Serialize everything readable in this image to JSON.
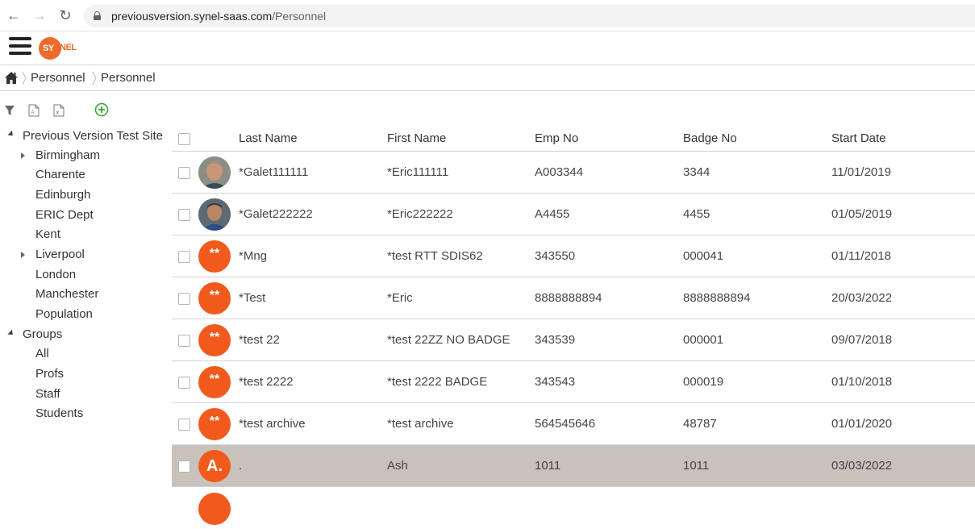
{
  "browser": {
    "url_host": "previousversion.synel-saas.com",
    "url_path": "/Personnel"
  },
  "app": {
    "logo_circle_text": "SY",
    "logo_rest_text": "NEL"
  },
  "breadcrumb": [
    "Personnel",
    "Personnel"
  ],
  "tree": {
    "site": "Previous Version Test Site",
    "departments": [
      {
        "label": "Birmingham",
        "expandable": true
      },
      {
        "label": "Charente",
        "expandable": false
      },
      {
        "label": "Edinburgh",
        "expandable": false
      },
      {
        "label": "ERIC Dept",
        "expandable": false
      },
      {
        "label": "Kent",
        "expandable": false
      },
      {
        "label": "Liverpool",
        "expandable": true
      },
      {
        "label": "London",
        "expandable": false
      },
      {
        "label": "Manchester",
        "expandable": false
      },
      {
        "label": "Population",
        "expandable": false
      }
    ],
    "groups_label": "Groups",
    "groups": [
      "All",
      "Profs",
      "Staff",
      "Students"
    ]
  },
  "grid": {
    "columns": {
      "last_name": "Last Name",
      "first_name": "First Name",
      "emp_no": "Emp No",
      "badge_no": "Badge No",
      "start_date": "Start Date"
    },
    "rows": [
      {
        "avatar_type": "photo",
        "avatar_text": "",
        "last_name": "*Galet111111",
        "first_name": "*Eric111111",
        "emp_no": "A003344",
        "badge_no": "3344",
        "start_date": "11/01/2019",
        "selected": false
      },
      {
        "avatar_type": "photo",
        "avatar_text": "",
        "last_name": "*Galet222222",
        "first_name": "*Eric222222",
        "emp_no": "A4455",
        "badge_no": "4455",
        "start_date": "01/05/2019",
        "selected": false
      },
      {
        "avatar_type": "stars",
        "avatar_text": "**",
        "last_name": "*Mng",
        "first_name": "*test RTT SDIS62",
        "emp_no": "343550",
        "badge_no": "000041",
        "start_date": "01/11/2018",
        "selected": false
      },
      {
        "avatar_type": "stars",
        "avatar_text": "**",
        "last_name": "*Test",
        "first_name": "*Eric",
        "emp_no": "8888888894",
        "badge_no": "8888888894",
        "start_date": "20/03/2022",
        "selected": false
      },
      {
        "avatar_type": "stars",
        "avatar_text": "**",
        "last_name": "*test 22",
        "first_name": "*test 22ZZ NO BADGE",
        "emp_no": "343539",
        "badge_no": "000001",
        "start_date": "09/07/2018",
        "selected": false
      },
      {
        "avatar_type": "stars",
        "avatar_text": "**",
        "last_name": "*test 2222",
        "first_name": "*test 2222 BADGE",
        "emp_no": "343543",
        "badge_no": "000019",
        "start_date": "01/10/2018",
        "selected": false
      },
      {
        "avatar_type": "stars",
        "avatar_text": "**",
        "last_name": "*test archive",
        "first_name": "*test archive",
        "emp_no": "564545646",
        "badge_no": "48787",
        "start_date": "01/01/2020",
        "selected": false
      },
      {
        "avatar_type": "initials",
        "avatar_text": "A.",
        "last_name": ".",
        "first_name": "Ash",
        "emp_no": "1011",
        "badge_no": "1011",
        "start_date": "03/03/2022",
        "selected": true
      }
    ]
  },
  "colors": {
    "accent_orange": "#f15a1c",
    "selected_row": "#c8c1bc",
    "add_icon_green": "#3aa635"
  }
}
